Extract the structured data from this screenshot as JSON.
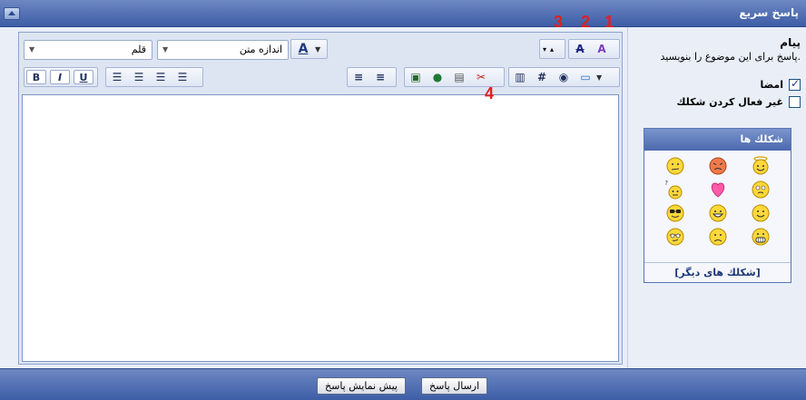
{
  "header": {
    "title": "پاسخ سريع"
  },
  "message": {
    "label": "پيام",
    "description": "پاسخ براى اين موضوع را بنويسيد."
  },
  "options": [
    {
      "label": "امضا",
      "checked": true
    },
    {
      "label": "غير فعال كردن شكلك",
      "checked": false
    }
  ],
  "smilies": {
    "title": "شكلك ها",
    "more": "[شكلك هاى ديگر]",
    "icons": [
      "angel-smiley-icon",
      "angry-smiley-icon",
      "confused-smiley-icon",
      "rolleyes-smiley-icon",
      "heart-icon",
      "question-smiley-icon",
      "smile-smiley-icon",
      "happy-smiley-icon",
      "cool-smiley-icon",
      "grin-smiley-icon",
      "frown-smiley-icon",
      "shades-smiley-icon"
    ]
  },
  "toolbar": {
    "font_placeholder": "قلم",
    "size_placeholder": "اندازه متن",
    "bold": "B",
    "italic": "I",
    "underline": "U",
    "hash": "#"
  },
  "annotations": [
    "1",
    "2",
    "3",
    "4"
  ],
  "buttons": {
    "submit": "ارسال پاسخ",
    "preview": "پيش نمايش پاسخ"
  },
  "colors": {
    "header": "#4a68ad",
    "accent": "#e02020"
  }
}
